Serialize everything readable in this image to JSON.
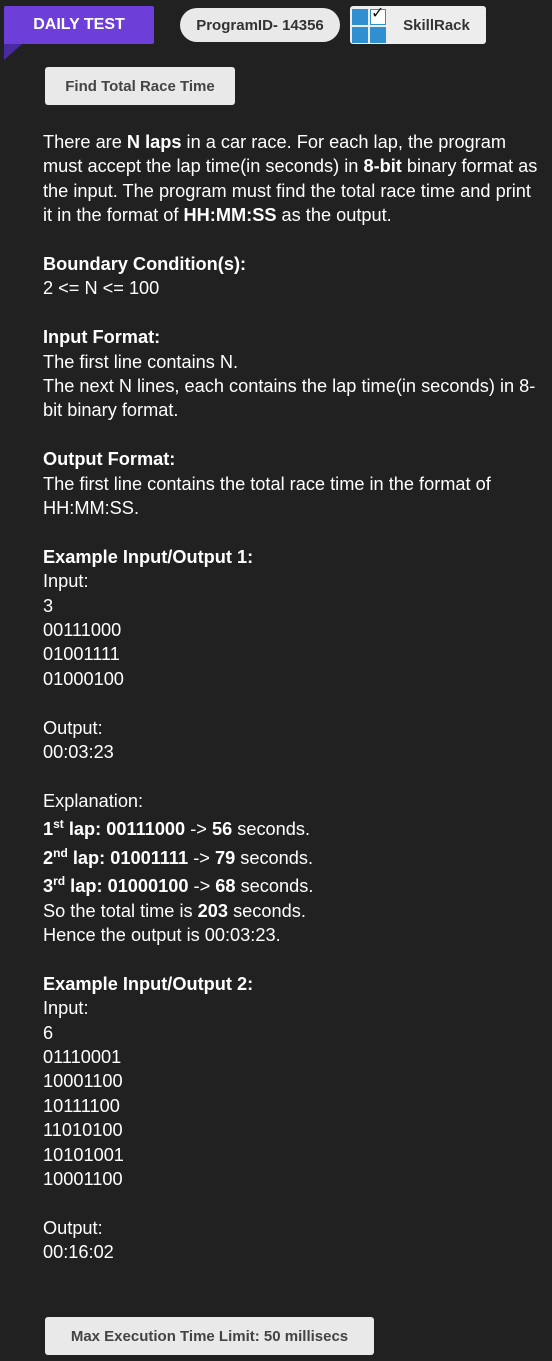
{
  "header": {
    "badge": "DAILY TEST",
    "program_id": "ProgramID- 14356",
    "brand": "SkillRack"
  },
  "problem": {
    "title": "Find Total Race Time",
    "description": {
      "p1": "There are ",
      "b1": "N laps",
      "p2": " in a car race. For each lap, the program must accept the lap time(in seconds) in ",
      "b2": "8-bit",
      "p3": " binary format as the input. The program must find the total race time and print it in the format of ",
      "b3": "HH:MM:SS",
      "p4": " as the output."
    },
    "boundary": {
      "heading": "Boundary Condition(s):",
      "text": "2 <= N <= 100"
    },
    "input_format": {
      "heading": "Input Format:",
      "line1": "The first line contains N.",
      "line2": "The next N lines, each contains the lap time(in seconds) in 8-bit binary format."
    },
    "output_format": {
      "heading": "Output Format:",
      "line1": "The first line contains the total race time in the format of HH:MM:SS."
    },
    "example1": {
      "heading": "Example Input/Output 1:",
      "input_label": "Input:",
      "input_lines": [
        "3",
        "00111000",
        "01001111",
        "01000100"
      ],
      "output_label": "Output:",
      "output": "00:03:23",
      "explanation_label": "Explanation:",
      "laps": [
        {
          "num": "1",
          "sup": "st",
          "bin": "00111000",
          "arrow": " -> ",
          "sec": "56",
          "unit": " seconds."
        },
        {
          "num": "2",
          "sup": "nd",
          "bin": "01001111",
          "arrow": " -> ",
          "sec": "79",
          "unit": " seconds."
        },
        {
          "num": "3",
          "sup": "rd",
          "bin": "01000100",
          "arrow": " -> ",
          "sec": "68",
          "unit": " seconds."
        }
      ],
      "lap_word": " lap: ",
      "total_pre": "So the total time is ",
      "total_val": "203",
      "total_post": " seconds.",
      "hence": "Hence the output is 00:03:23."
    },
    "example2": {
      "heading": "Example Input/Output 2:",
      "input_label": "Input:",
      "input_lines": [
        "6",
        "01110001",
        "10001100",
        "10111100",
        "11010100",
        "10101001",
        "10001100"
      ],
      "output_label": "Output:",
      "output": "00:16:02"
    },
    "limit": "Max Execution Time Limit: 50 millisecs"
  }
}
